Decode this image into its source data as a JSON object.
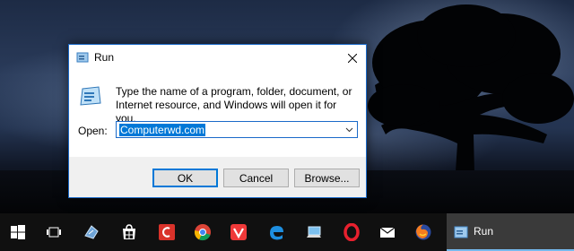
{
  "dialog": {
    "title": "Run",
    "description": "Type the name of a program, folder, document, or Internet resource, and Windows will open it for you.",
    "open_label": "Open:",
    "open_value": "Computerwd.com",
    "ok_label": "OK",
    "cancel_label": "Cancel",
    "browse_label": "Browse..."
  },
  "taskbar": {
    "items": [
      "windows-start-icon",
      "task-view-icon",
      "app-3d-icon",
      "store-icon",
      "ccleaner-icon",
      "chrome-icon",
      "vivaldi-icon",
      "edge-icon",
      "this-pc-icon",
      "opera-icon",
      "mail-icon",
      "firefox-icon"
    ],
    "active_label": "Run"
  },
  "colors": {
    "accent": "#0078d7",
    "taskbar": "#101010",
    "dialog_border": "#1b6ac9"
  }
}
